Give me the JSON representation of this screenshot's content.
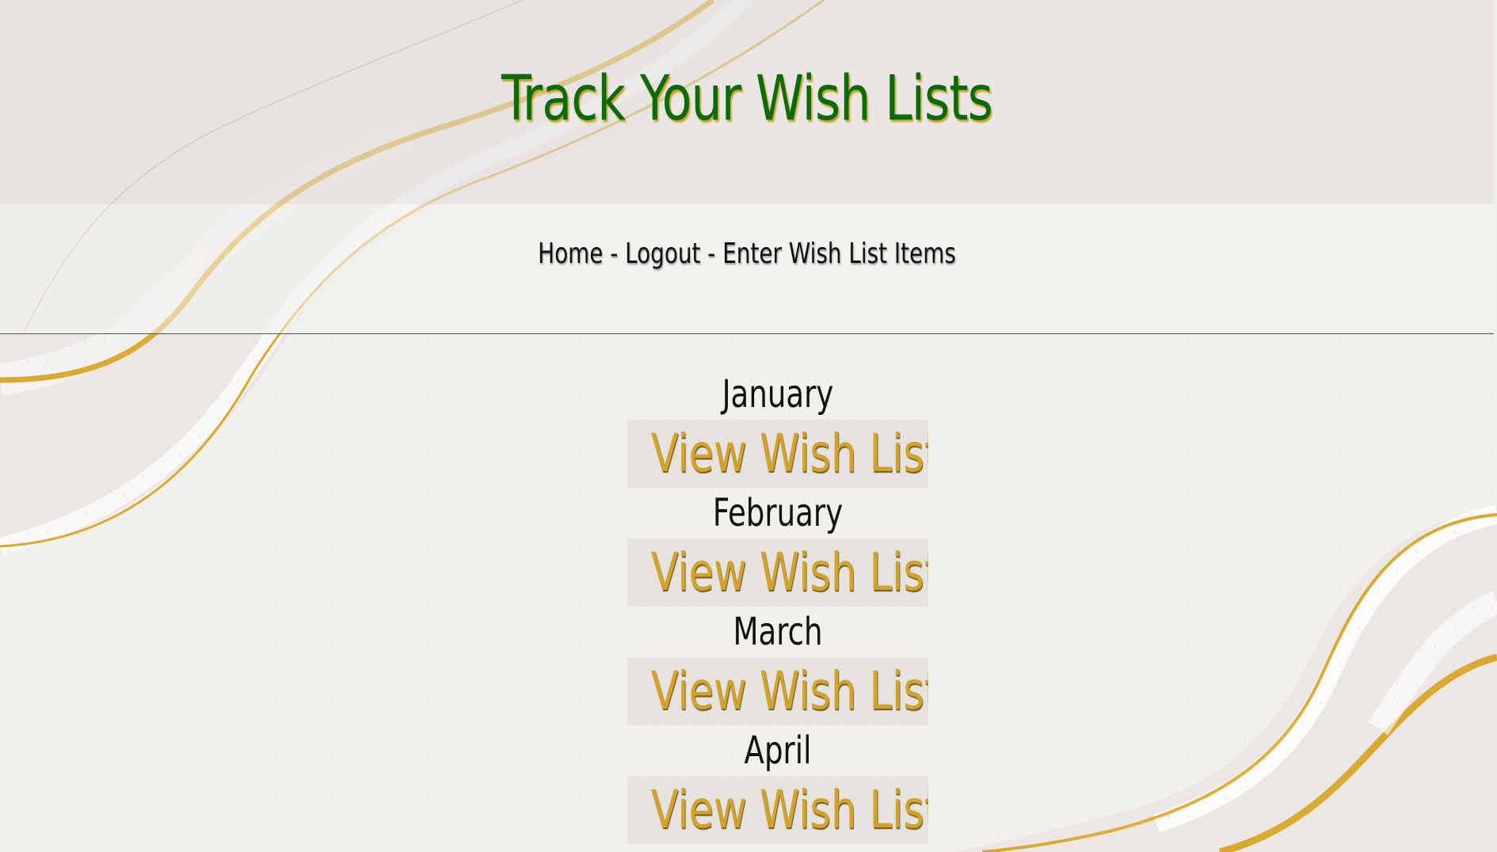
{
  "header": {
    "title": "Track Your Wish Lists"
  },
  "nav": {
    "home_label": "Home",
    "separator_1": " - ",
    "logout_label": "Logout",
    "separator_2": " - ",
    "enter_items_label": "Enter Wish List Items"
  },
  "months": [
    {
      "name": "January",
      "link_label": "View Wish List"
    },
    {
      "name": "February",
      "link_label": "View Wish List"
    },
    {
      "name": "March",
      "link_label": "View Wish List"
    },
    {
      "name": "April",
      "link_label": "View Wish List"
    }
  ],
  "colors": {
    "title": "#0b6a0b",
    "title_shadow": "#c9a12e",
    "link": "#d3a22a",
    "text": "#111111",
    "background": "#f3f1ec"
  }
}
